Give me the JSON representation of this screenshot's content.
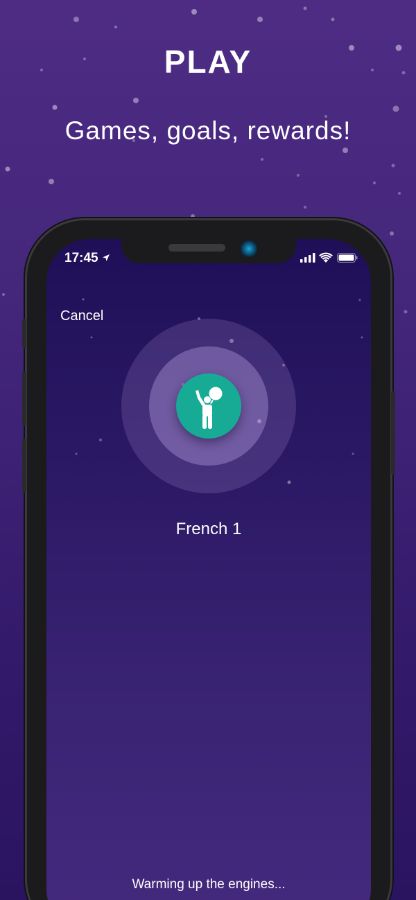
{
  "header": {
    "title": "PLAY",
    "subtitle": "Games, goals, rewards!"
  },
  "status_bar": {
    "time": "17:45",
    "icons": [
      "location-arrow-icon",
      "signal-icon",
      "wifi-icon",
      "battery-icon"
    ]
  },
  "screen": {
    "cancel_label": "Cancel",
    "avatar_icon": "person-waving-icon",
    "course_name": "French 1",
    "loading_text": "Warming up the engines..."
  },
  "colors": {
    "background": "#4e2c84",
    "screen_background": "#2a1864",
    "avatar_accent": "#17ab96",
    "text": "#ffffff"
  }
}
